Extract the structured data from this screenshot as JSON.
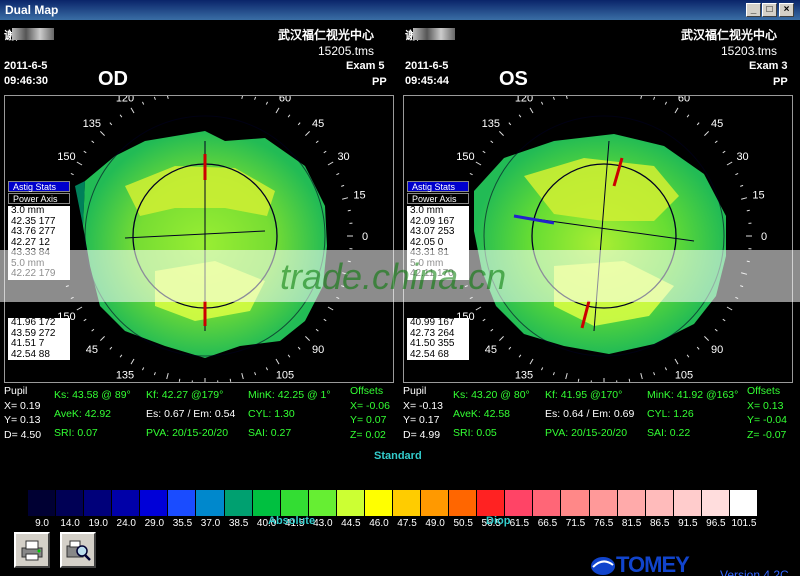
{
  "window": {
    "title": "Dual Map",
    "min": "_",
    "max": "□",
    "close": "×"
  },
  "od": {
    "name": "谢,",
    "clinic": "武汉福仁视光中心",
    "file": "15205.tms",
    "date": "2011-6-5",
    "time": "09:46:30",
    "exam": "Exam 5",
    "pp": "PP",
    "eye": "OD",
    "legend_astig": "Astig Stats",
    "legend_power": "Power Axis",
    "legend_3mm": [
      "3.0 mm",
      "42.35 177",
      "43.76 277",
      "42.27  12",
      "43.33  84"
    ],
    "legend_5mm": [
      "5.0 mm",
      "42.22 179"
    ],
    "legend_7mm": [
      "41.96 172",
      "43.59 272",
      "41.51   7",
      "42.54  88"
    ],
    "labels": [
      "90",
      "105",
      "75",
      "120",
      "60",
      "135",
      "45",
      "150",
      "30",
      "15",
      "0",
      "150",
      "45",
      "135",
      "60",
      "120",
      "75",
      "105",
      "90"
    ],
    "pupil": "Pupil",
    "x": "X=  0.19",
    "y": "Y=  0.13",
    "d": "D=  4.50",
    "ks": "Ks: 43.58 @ 89°",
    "kf": "Kf: 42.27 @179°",
    "mink": "MinK: 42.25 @  1°",
    "avek": "AveK: 42.92",
    "es": "Es: 0.67 / Em: 0.54",
    "cyl": "CYL:  1.30",
    "sri": "SRI: 0.07",
    "pva": "PVA: 20/15-20/20",
    "sai": "SAI: 0.27",
    "offsets": "Offsets",
    "ox": "X= -0.06",
    "oy": "Y=  0.07",
    "oz": "Z=  0.02"
  },
  "os": {
    "name": "谢,",
    "clinic": "武汉福仁视光中心",
    "file": "15203.tms",
    "date": "2011-6-5",
    "time": "09:45:44",
    "exam": "Exam 3",
    "pp": "PP",
    "eye": "OS",
    "legend_astig": "Astig Stats",
    "legend_power": "Power Axis",
    "legend_3mm": [
      "3.0 mm",
      "42.09 167",
      "43.07 253",
      "42.05   0",
      "43.31  81"
    ],
    "legend_5mm": [
      "5.0 mm",
      "42.11 170"
    ],
    "legend_7mm": [
      "40.99 167",
      "42.73 264",
      "41.50 355",
      "42.54  68"
    ],
    "labels": [
      "90",
      "105",
      "75",
      "120",
      "60",
      "135",
      "45",
      "150",
      "30",
      "15",
      "0",
      "150",
      "45",
      "135",
      "60",
      "120",
      "75",
      "105",
      "90"
    ],
    "pupil": "Pupil",
    "x": "X= -0.13",
    "y": "Y=  0.17",
    "d": "D=  4.99",
    "ks": "Ks: 43.20 @ 80°",
    "kf": "Kf: 41.95 @170°",
    "mink": "MinK: 41.92 @163°",
    "avek": "AveK: 42.58",
    "es": "Es: 0.64 / Em: 0.69",
    "cyl": "CYL:  1.26",
    "sri": "SRI: 0.05",
    "pva": "PVA: 20/15-20/20",
    "sai": "SAI: 0.22",
    "offsets": "Offsets",
    "ox": "X=  0.13",
    "oy": "Y= -0.04",
    "oz": "Z= -0.07"
  },
  "scale": {
    "title": "Standard",
    "left_label": "Absolute",
    "right_label": "Diop",
    "values": [
      "9.0",
      "14.0",
      "19.0",
      "24.0",
      "29.0",
      "35.5",
      "37.0",
      "38.5",
      "40.0",
      "41.5",
      "43.0",
      "44.5",
      "46.0",
      "47.5",
      "49.0",
      "50.5",
      "56.5",
      "61.5",
      "66.5",
      "71.5",
      "76.5",
      "81.5",
      "86.5",
      "91.5",
      "96.5",
      "101.5"
    ],
    "colors": [
      "#000033",
      "#000055",
      "#00007a",
      "#0000a8",
      "#0000d8",
      "#1a4cff",
      "#0088cc",
      "#00a070",
      "#00c040",
      "#33dd33",
      "#66ee33",
      "#ccff33",
      "#ffff00",
      "#ffcc00",
      "#ff9900",
      "#ff6600",
      "#ff2222",
      "#ff4466",
      "#ff6677",
      "#ff8888",
      "#ff9999",
      "#ffaaaa",
      "#ffbbbb",
      "#ffcccc",
      "#ffdddd",
      "#ffffff"
    ]
  },
  "toolbar": {
    "print_icon": "printer-icon",
    "zoom_icon": "zoom-icon"
  },
  "brand": {
    "logo": "TOMEY",
    "version": "Version 4.2C"
  },
  "watermark": "trade.china.cn"
}
